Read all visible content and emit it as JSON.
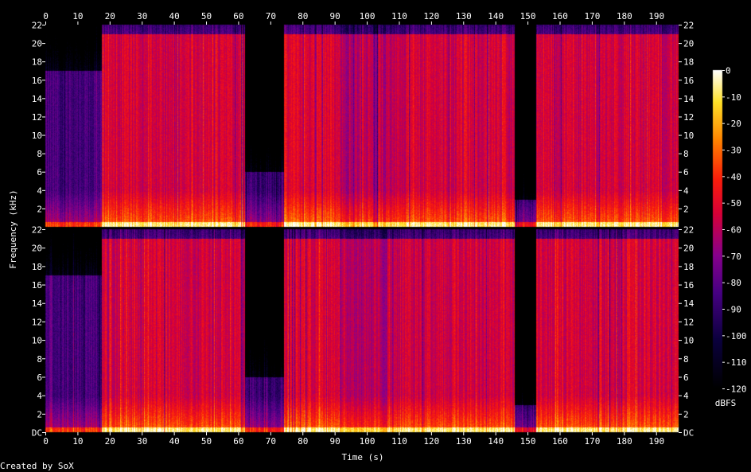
{
  "chart_data": {
    "type": "heatmap",
    "title": "",
    "xlabel": "Time (s)",
    "ylabel": "Frequency (kHz)",
    "xlim": [
      0,
      197
    ],
    "ylim": [
      0,
      22
    ],
    "x_ticks": [
      0,
      10,
      20,
      30,
      40,
      50,
      60,
      70,
      80,
      90,
      100,
      110,
      120,
      130,
      140,
      150,
      160,
      170,
      180,
      190
    ],
    "x_tick_labels": [
      "0",
      "10",
      "20",
      "30",
      "40",
      "50",
      "60",
      "70",
      "80",
      "90",
      "100",
      "110",
      "120",
      "130",
      "140",
      "150",
      "160",
      "170",
      "180",
      "190"
    ],
    "channels": [
      {
        "y_ticks": [
          0,
          2,
          4,
          6,
          8,
          10,
          12,
          14,
          16,
          18,
          20,
          22
        ],
        "y_tick_labels": [
          "DC",
          "2",
          "4",
          "6",
          "8",
          "10",
          "12",
          "14",
          "16",
          "18",
          "20",
          "22"
        ]
      },
      {
        "y_ticks": [
          2,
          4,
          6,
          8,
          10,
          12,
          14,
          16,
          18,
          20,
          22
        ],
        "y_tick_labels": [
          "2",
          "4",
          "6",
          "8",
          "10",
          "12",
          "14",
          "16",
          "18",
          "20",
          "22"
        ]
      }
    ],
    "colorbar": {
      "label": "dBFS",
      "range": [
        -120,
        0
      ],
      "ticks": [
        0,
        -10,
        -20,
        -30,
        -40,
        -50,
        -60,
        -70,
        -80,
        -90,
        -100,
        -110,
        -120
      ],
      "tick_labels": [
        "0",
        "-10",
        "-20",
        "-30",
        "-40",
        "-50",
        "-60",
        "-70",
        "-80",
        "-90",
        "-100",
        "-110",
        "-120"
      ]
    },
    "segments": [
      {
        "start": 0,
        "end": 17.5,
        "level_db": -85,
        "cutoff_khz": 17
      },
      {
        "start": 17.5,
        "end": 62,
        "level_db": -55,
        "cutoff_khz": 21
      },
      {
        "start": 62,
        "end": 74,
        "level_db": -88,
        "cutoff_khz": 6
      },
      {
        "start": 74,
        "end": 91.5,
        "level_db": -52,
        "cutoff_khz": 21
      },
      {
        "start": 91.5,
        "end": 108.5,
        "level_db": -62,
        "cutoff_khz": 21
      },
      {
        "start": 108.5,
        "end": 146,
        "level_db": -55,
        "cutoff_khz": 21
      },
      {
        "start": 146,
        "end": 152.5,
        "level_db": -95,
        "cutoff_khz": 3
      },
      {
        "start": 152.5,
        "end": 197,
        "level_db": -55,
        "cutoff_khz": 21
      }
    ]
  },
  "footer": {
    "credit": "Created by SoX"
  }
}
